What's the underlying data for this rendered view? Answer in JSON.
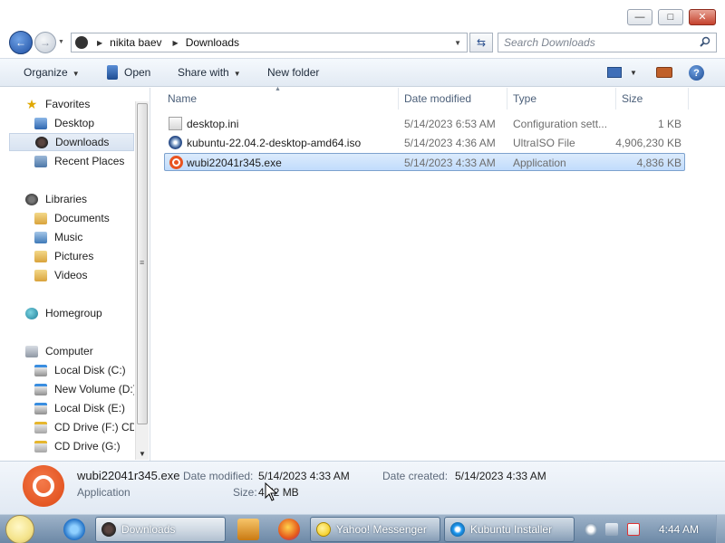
{
  "window": {
    "minimize_glyph": "—",
    "maximize_glyph": "□",
    "close_glyph": "✕"
  },
  "address": {
    "crumbs": [
      "nikita baev",
      "Downloads"
    ],
    "search_placeholder": "Search Downloads"
  },
  "toolbar": {
    "organize": "Organize",
    "open": "Open",
    "share_with": "Share with",
    "new_folder": "New folder"
  },
  "nav": {
    "favorites": "Favorites",
    "desktop": "Desktop",
    "downloads": "Downloads",
    "recent_places": "Recent Places",
    "libraries": "Libraries",
    "documents": "Documents",
    "music": "Music",
    "pictures": "Pictures",
    "videos": "Videos",
    "homegroup": "Homegroup",
    "computer": "Computer",
    "local_disk_c": "Local Disk (C:)",
    "new_volume_d": "New Volume (D:)",
    "local_disk_e": "Local Disk (E:)",
    "cd_drive_f": "CD Drive (F:) CDR",
    "cd_drive_g": "CD Drive (G:)"
  },
  "columns": {
    "name": "Name",
    "date_modified": "Date modified",
    "type": "Type",
    "size": "Size"
  },
  "files": [
    {
      "name": "desktop.ini",
      "date": "5/14/2023 6:53 AM",
      "type": "Configuration sett...",
      "size": "1 KB"
    },
    {
      "name": "kubuntu-22.04.2-desktop-amd64.iso",
      "date": "5/14/2023 4:36 AM",
      "type": "UltraISO File",
      "size": "4,906,230 KB"
    },
    {
      "name": "wubi22041r345.exe",
      "date": "5/14/2023 4:33 AM",
      "type": "Application",
      "size": "4,836 KB"
    }
  ],
  "details": {
    "name": "wubi22041r345.exe",
    "type": "Application",
    "date_modified_label": "Date modified:",
    "date_modified": "5/14/2023 4:33 AM",
    "date_created_label": "Date created:",
    "date_created": "5/14/2023 4:33 AM",
    "size_label": "Size:",
    "size": "4.72 MB"
  },
  "taskbar": {
    "downloads": "Downloads",
    "yahoo": "Yahoo! Messenger",
    "kubuntu": "Kubuntu Installer",
    "clock": "4:44 AM"
  }
}
